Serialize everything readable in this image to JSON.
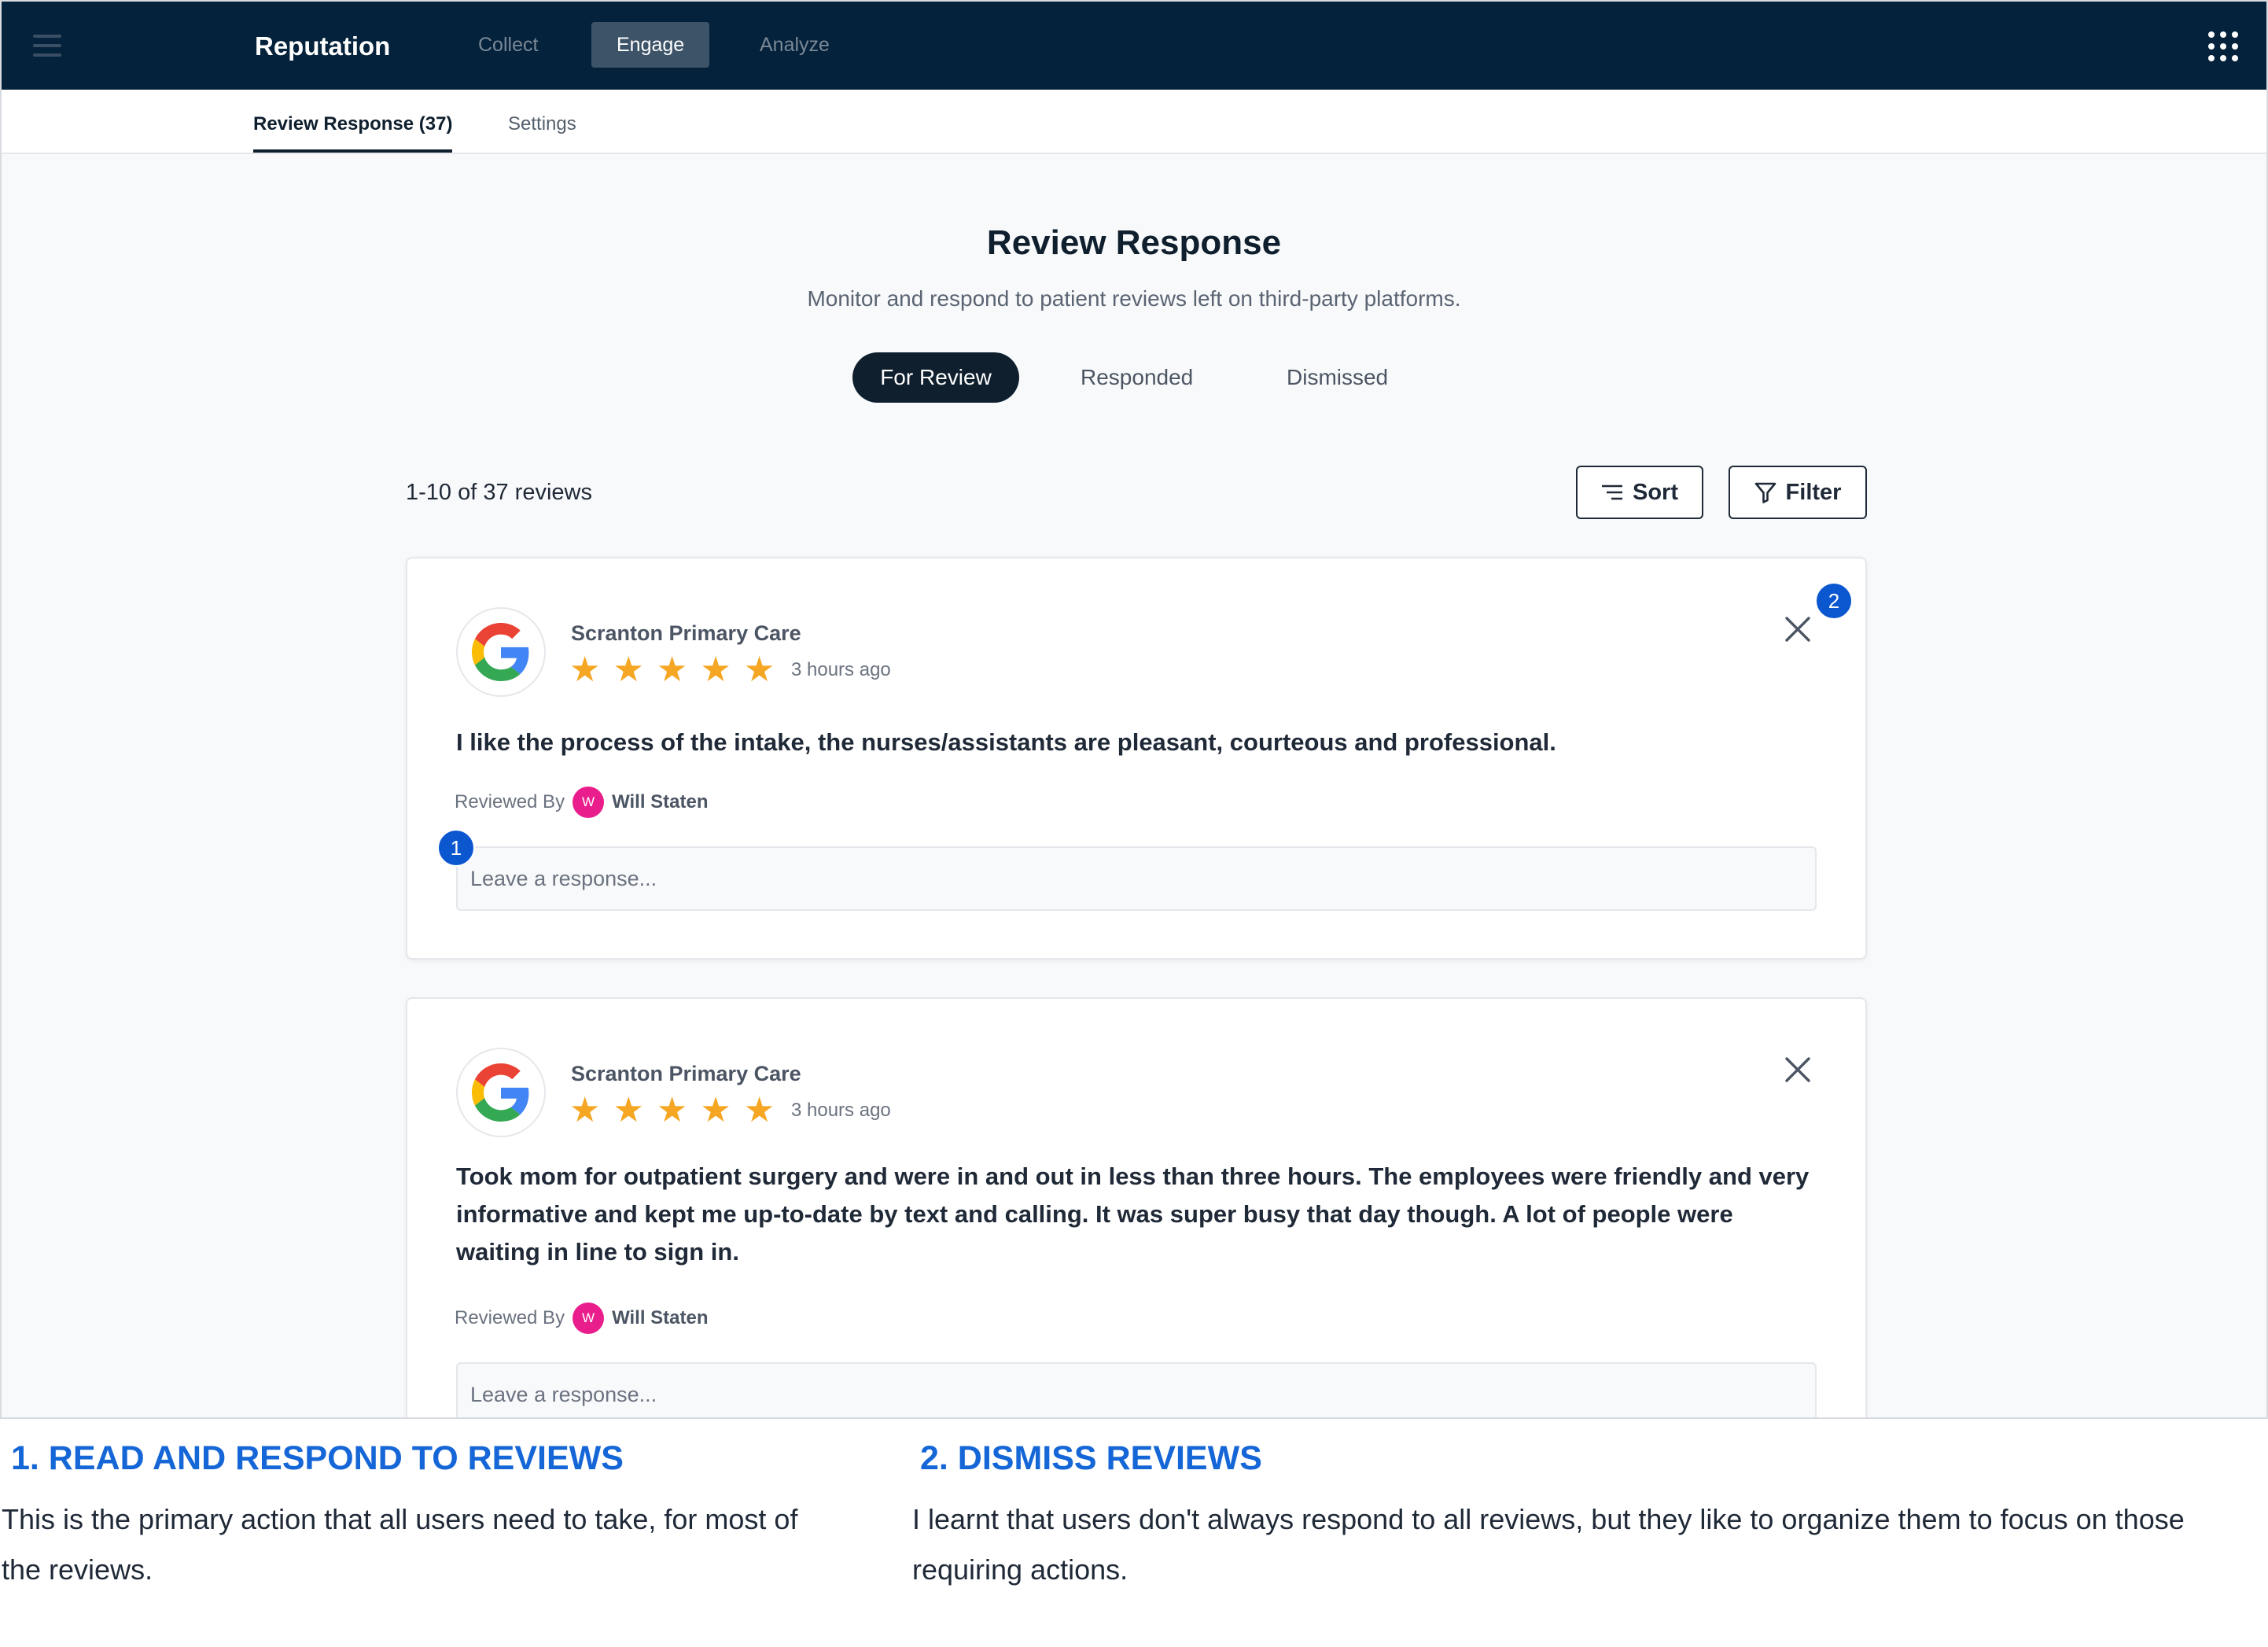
{
  "topbar": {
    "brand": "Reputation",
    "nav": [
      {
        "label": "Collect"
      },
      {
        "label": "Engage"
      },
      {
        "label": "Analyze"
      }
    ]
  },
  "subnav": {
    "tabs": [
      {
        "label": "Review Response (37)"
      },
      {
        "label": "Settings"
      }
    ]
  },
  "page": {
    "title": "Review Response",
    "subtitle": "Monitor and respond to patient reviews left on third-party platforms.",
    "status_tabs": [
      {
        "label": "For Review"
      },
      {
        "label": "Responded"
      },
      {
        "label": "Dismissed"
      }
    ],
    "count_text": "1-10 of 37 reviews",
    "sort_label": "Sort",
    "filter_label": "Filter"
  },
  "reviews": [
    {
      "location": "Scranton Primary Care",
      "rating": 5,
      "time": "3 hours ago",
      "text": "I like the process of the intake, the nurses/assistants are pleasant, courteous and professional.",
      "reviewed_by_label": "Reviewed By",
      "avatar_initial": "W",
      "reviewer": "Will Staten",
      "response_placeholder": "Leave a response..."
    },
    {
      "location": "Scranton Primary Care",
      "rating": 5,
      "time": "3 hours ago",
      "text": "Took mom for outpatient surgery and were in and out in less than three hours. The employees were friendly and very informative and kept me up-to-date by text and calling. It was super busy that day though. A lot of people were waiting in line to sign in.",
      "reviewed_by_label": "Reviewed By",
      "avatar_initial": "W",
      "reviewer": "Will Staten",
      "response_placeholder": "Leave a response..."
    }
  ],
  "markers": [
    "1",
    "2"
  ],
  "annotations": [
    {
      "title": "1. READ AND RESPOND TO REVIEWS",
      "body": "This is the primary action that all users need to take, for most of the reviews."
    },
    {
      "title": "2. DISMISS REVIEWS",
      "body": "I learnt that users don't always respond to all reviews, but they like to organize them to focus on those requiring actions."
    }
  ],
  "colors": {
    "topbar": "#04223b",
    "active_tab": "#0f1f2e",
    "star": "#f5a623",
    "avatar": "#e91e8c",
    "marker": "#0b57d0",
    "annotation_heading": "#1566d6"
  },
  "icons": [
    "menu-icon",
    "app-grid-icon",
    "sort-icon",
    "filter-icon",
    "google-logo-icon",
    "star-icon",
    "close-icon"
  ]
}
